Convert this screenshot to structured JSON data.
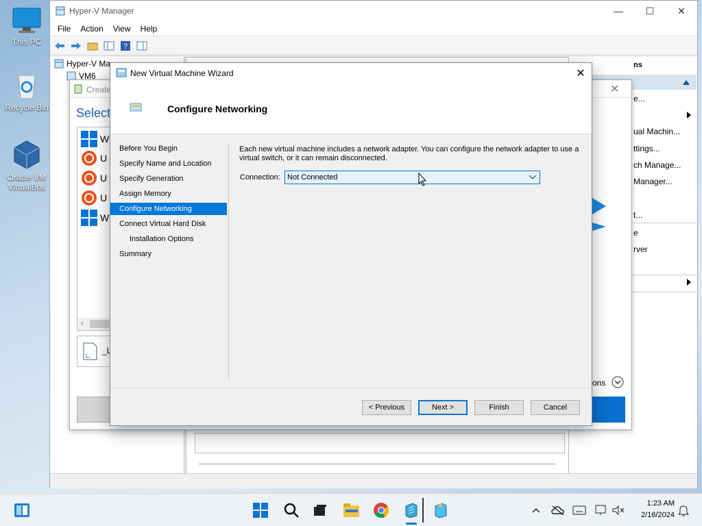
{
  "desktop": {
    "icons": [
      {
        "label": "This PC"
      },
      {
        "label": "Recycle Bin"
      },
      {
        "label": "Oracle VM VirtualBox"
      }
    ]
  },
  "hyperv": {
    "title": "Hyper-V Manager",
    "menu": [
      "File",
      "Action",
      "View",
      "Help"
    ],
    "tree": {
      "root": "Hyper-V Ma",
      "node": "VM6"
    },
    "actions_header": "ns",
    "actions": [
      "e...",
      "ual Machin...",
      "ttings...",
      "ch Manage...",
      "Manager...",
      "t...",
      "e",
      "rver"
    ],
    "more_actions": "tions"
  },
  "create_wizard": {
    "title": "Create",
    "heading": "Select",
    "list_letters": [
      "W",
      "U",
      "U",
      "U",
      "W"
    ],
    "file_label": "_L"
  },
  "wizard": {
    "title": "New Virtual Machine Wizard",
    "heading": "Configure Networking",
    "nav": [
      "Before You Begin",
      "Specify Name and Location",
      "Specify Generation",
      "Assign Memory",
      "Configure Networking",
      "Connect Virtual Hard Disk",
      "Installation Options",
      "Summary"
    ],
    "description": "Each new virtual machine includes a network adapter. You can configure the network adapter to use a virtual switch, or it can remain disconnected.",
    "connection_label": "Connection:",
    "connection_value": "Not Connected",
    "buttons": {
      "previous": "< Previous",
      "next": "Next >",
      "finish": "Finish",
      "cancel": "Cancel"
    }
  },
  "taskbar": {
    "time": "1:23 AM",
    "date": "2/16/2024"
  },
  "colors": {
    "accent": "#0078d7"
  }
}
